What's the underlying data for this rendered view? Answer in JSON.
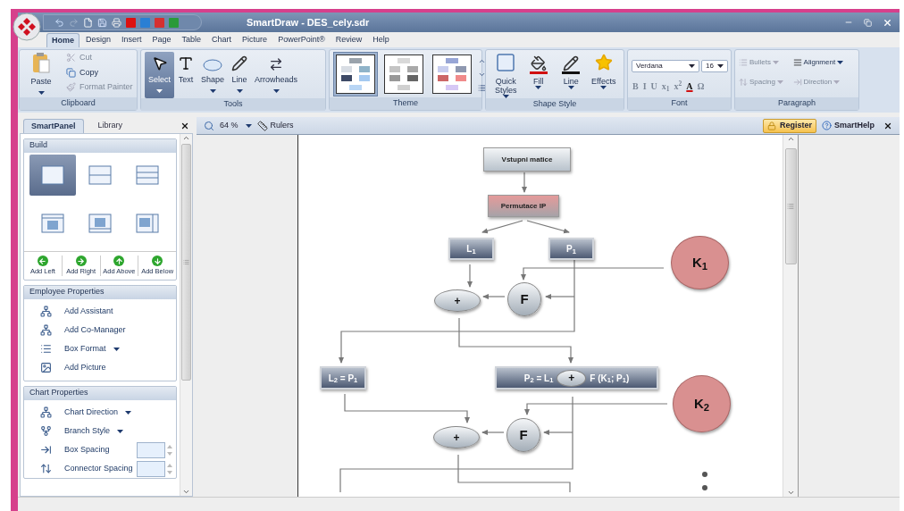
{
  "window": {
    "title": "SmartDraw - DES_cely.sdr"
  },
  "ribbon_tabs": [
    {
      "label": "Home",
      "selected": true
    },
    {
      "label": "Design",
      "selected": false
    },
    {
      "label": "Insert",
      "selected": false
    },
    {
      "label": "Page",
      "selected": false
    },
    {
      "label": "Table",
      "selected": false
    },
    {
      "label": "Chart",
      "selected": false
    },
    {
      "label": "Picture",
      "selected": false
    },
    {
      "label": "PowerPoint®",
      "selected": false
    },
    {
      "label": "Review",
      "selected": false
    },
    {
      "label": "Help",
      "selected": false
    }
  ],
  "clipboard": {
    "label": "Clipboard",
    "paste": "Paste",
    "items": [
      {
        "label": "Cut",
        "disabled": true
      },
      {
        "label": "Copy",
        "disabled": false
      },
      {
        "label": "Format Painter",
        "disabled": true
      }
    ]
  },
  "tools": {
    "label": "Tools",
    "items": [
      {
        "label": "Select",
        "selected": true,
        "dropdown": true
      },
      {
        "label": "Text",
        "selected": false,
        "dropdown": false
      },
      {
        "label": "Shape",
        "selected": false,
        "dropdown": true
      },
      {
        "label": "Line",
        "selected": false,
        "dropdown": true
      },
      {
        "label": "Arrowheads",
        "selected": false,
        "dropdown": true
      }
    ]
  },
  "theme": {
    "label": "Theme",
    "themes": [
      {
        "selected": true
      },
      {
        "selected": false
      },
      {
        "selected": false
      }
    ]
  },
  "shape_style": {
    "label": "Shape Style",
    "items": [
      {
        "label": "Quick Styles",
        "kind": "quick"
      },
      {
        "label": "Fill",
        "kind": "fill"
      },
      {
        "label": "Line",
        "kind": "line"
      },
      {
        "label": "Effects",
        "kind": "effects"
      }
    ]
  },
  "font": {
    "label": "Font",
    "font_name": "Verdana",
    "font_size": "16",
    "format_buttons": [
      {
        "label": "B",
        "disabled": true
      },
      {
        "label": "I",
        "disabled": true
      },
      {
        "label": "U",
        "disabled": true
      },
      {
        "label": "x$_{1}$",
        "disabled": true
      },
      {
        "label": "x$^{2}$",
        "disabled": true
      },
      {
        "label": "A",
        "disabled": false
      },
      {
        "label": "Ω",
        "disabled": true
      }
    ]
  },
  "paragraph": {
    "label": "Paragraph",
    "items": [
      {
        "label": "Bullets",
        "disabled": true
      },
      {
        "label": "Alignment",
        "disabled": false
      },
      {
        "label": "Spacing",
        "disabled": true
      },
      {
        "label": "Direction",
        "disabled": true
      }
    ]
  },
  "side_panel": {
    "tabs": [
      {
        "label": "SmartPanel",
        "selected": true
      },
      {
        "label": "Library",
        "selected": false
      }
    ],
    "build": {
      "title": "Build",
      "layouts": [
        {
          "selected": true
        },
        {
          "selected": false
        },
        {
          "selected": false
        },
        {
          "selected": false
        },
        {
          "selected": false
        },
        {
          "selected": false
        }
      ],
      "add_buttons": [
        {
          "label": "Add Left",
          "kind": "left"
        },
        {
          "label": "Add Right",
          "kind": "right"
        },
        {
          "label": "Add Above",
          "kind": "up"
        },
        {
          "label": "Add Below",
          "kind": "down"
        }
      ]
    },
    "employee_properties": {
      "title": "Employee Properties",
      "items": [
        {
          "label": "Add Assistant",
          "kind": "action"
        },
        {
          "label": "Add Co-Manager",
          "kind": "action"
        },
        {
          "label": "Box Format",
          "kind": "dropdown"
        },
        {
          "label": "Add Picture",
          "kind": "action"
        }
      ]
    },
    "chart_properties": {
      "title": "Chart Properties",
      "items": [
        {
          "label": "Chart Direction",
          "kind": "dropdown"
        },
        {
          "label": "Branch Style",
          "kind": "dropdown"
        },
        {
          "label": "Box Spacing",
          "kind": "spinner"
        },
        {
          "label": "Connector Spacing",
          "kind": "spinner"
        }
      ]
    }
  },
  "canvas_toolbar": {
    "zoom": "64 %",
    "rulers": "Rulers",
    "register": "Register",
    "smarthelp": "SmartHelp"
  },
  "diagram": {
    "nodes": [
      {
        "kind": "box",
        "label": "Vstupni matice"
      },
      {
        "kind": "highlight_box",
        "label": "Permutace IP"
      },
      {
        "kind": "dark_box",
        "label": "L$_{1}$"
      },
      {
        "kind": "dark_box",
        "label": "P$_{1}$"
      },
      {
        "kind": "key_circle",
        "label": "K$_{1}$"
      },
      {
        "kind": "oval",
        "label": "+"
      },
      {
        "kind": "circle",
        "label": "F"
      },
      {
        "kind": "dark_box",
        "label": "L$_{2}$ = P$_{1}$"
      },
      {
        "kind": "formula_box",
        "label": "P$_{2}$ = L$_{1}$",
        "operator": "+",
        "label_2": "F (K$_{1}$; P$_{1}$)"
      },
      {
        "kind": "key_circle",
        "label": "K$_{2}$"
      },
      {
        "kind": "oval",
        "label": "+"
      },
      {
        "kind": "circle",
        "label": "F"
      }
    ]
  }
}
